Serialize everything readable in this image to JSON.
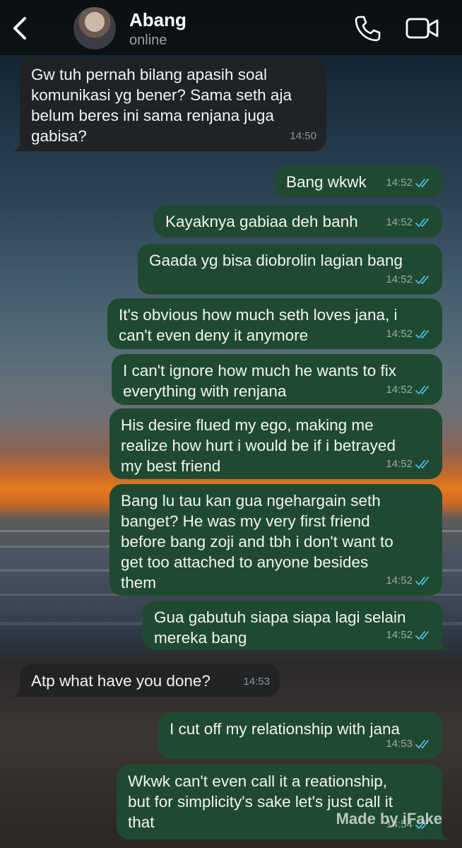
{
  "header": {
    "contact_name": "Abang",
    "contact_status": "online",
    "icons": [
      "back-icon",
      "call-icon",
      "video-call-icon"
    ]
  },
  "messages": [
    {
      "direction": "in",
      "text": "Gw tuh pernah bilang apasih soal\nkomunikasi yg bener? Sama seth aja\nbelum beres ini sama renjana juga\ngabisa?",
      "time": "14:50"
    },
    {
      "direction": "out",
      "text": "Bang wkwk",
      "time": "14:52",
      "read": true
    },
    {
      "direction": "out",
      "text": "Kayaknya gabiaa deh banh",
      "time": "14:52",
      "read": true
    },
    {
      "direction": "out",
      "text": "Gaada yg bisa diobrolin lagian bang",
      "time": "14:52",
      "read": true
    },
    {
      "direction": "out",
      "text": "It's obvious how much seth loves jana, i\ncan't even deny it anymore",
      "time": "14:52",
      "read": true
    },
    {
      "direction": "out",
      "text": "I can't ignore how much he wants to fix\neverything with renjana",
      "time": "14:52",
      "read": true
    },
    {
      "direction": "out",
      "text": "His desire flued my ego, making me\nrealize how hurt i would be if i betrayed\nmy best friend",
      "time": "14:52",
      "read": true
    },
    {
      "direction": "out",
      "text": "Bang lu tau kan gua ngehargain seth\nbanget? He was my very first friend\nbefore bang zoji and tbh i don't want to\nget too attached to anyone besides\nthem",
      "time": "14:52",
      "read": true
    },
    {
      "direction": "out",
      "text": "Gua gabutuh siapa siapa lagi selain\nmereka bang",
      "time": "14:52",
      "read": true
    },
    {
      "direction": "in",
      "text": "Atp what have you done?",
      "time": "14:53"
    },
    {
      "direction": "out",
      "text": "I cut off my relationship with jana",
      "time": "14:53",
      "read": true
    },
    {
      "direction": "out",
      "text": "Wkwk can't even call it a reationship,\nbut for simplicity's sake let's just call it\nthat",
      "time": "14:54",
      "read": true
    }
  ],
  "watermark": "Made by iFake",
  "colors": {
    "outgoing_bubble": "#1f4a31",
    "incoming_bubble": "#202224",
    "read_ticks": "#53bdeb",
    "header_bg": "#0c1012"
  }
}
